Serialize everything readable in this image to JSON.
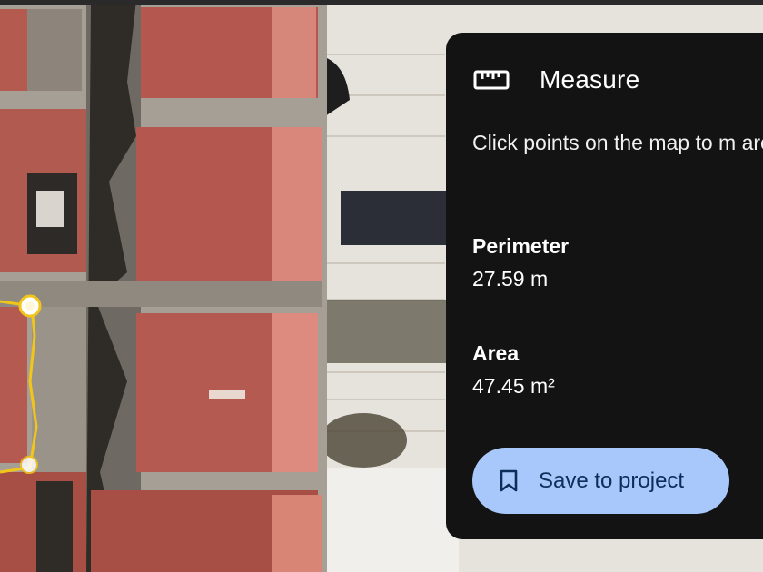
{
  "panel": {
    "title": "Measure",
    "instructions": "Click points on the map to m area",
    "perimeter": {
      "label": "Perimeter",
      "value": "27.59 m"
    },
    "area": {
      "label": "Area",
      "value": "47.45 m²"
    },
    "save_button": "Save to project"
  },
  "icons": {
    "title": "ruler-icon",
    "save": "bookmark-icon"
  },
  "colors": {
    "panel_bg": "#131313",
    "button_bg": "#a8c7fa",
    "button_text": "#0b2f5b",
    "measure_line": "#f2c619",
    "roof": "#b4574e"
  }
}
